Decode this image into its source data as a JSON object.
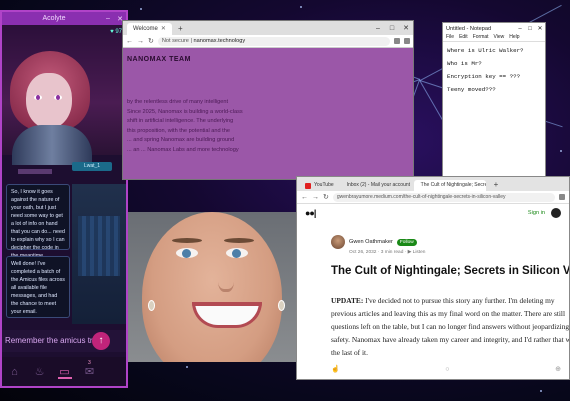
{
  "acolyte": {
    "title": "Acolyte",
    "indicator": "♥ 97",
    "name_tag": "Lwat_1",
    "chat_1": "So, I know it goes against the nature of your oath, but I just need some way to get a lot of info on hand that you can do... need to explain why so I can decipher the code in the meantime...",
    "chat_2": "Well done! I've completed a batch of the Amicus files across all available file messages, and had the chance to meet your email.",
    "prompt": "Remember the amicus trials",
    "nav_badge": "3"
  },
  "nanomax_browser": {
    "tab_label": "Welcome",
    "url_prefix": "Not secure",
    "url_domain": "nanomax.technology",
    "heading": "NANOMAX TEAM",
    "body_lines": [
      "by the relentless drive of many intelligent",
      "Since 2025, Nanomax is building a world-class",
      "shift in artificial intelligence. The underlying",
      "this proposition, with the potential and the",
      "... and spring Nanomax are building ground",
      "... an ... Nanomax Labs and more technology"
    ]
  },
  "notepad": {
    "title": "Untitled - Notepad",
    "menu": [
      "File",
      "Edit",
      "Format",
      "View",
      "Help"
    ],
    "lines": [
      "Where is Ulric Walker?",
      "Who is Mr?",
      "Encryption key == ???",
      "Teeny moved???"
    ]
  },
  "medium_browser": {
    "tabs": [
      "YouTube",
      "Inbox (2) - Mail your account",
      "The Cult of Nightingale; Secrets in"
    ],
    "url": "gwenbrayumore.medium.com/the-cult-of-nightingale-secrets-in-silicon-valley",
    "sign_in": "Sign in",
    "author_name": "Gwen Oathmaker",
    "follow_label": "Follow",
    "meta": "Oct 26, 2032 · 3 min read · ▶ Listen",
    "title": "The Cult of Nightingale; Secrets in Silicon Valley",
    "update_label": "UPDATE:",
    "body": "I've decided not to pursue this story any further. I'm deleting my previous articles and leaving this as my final word on the matter. There are still questions left on the table, but I can no longer find answers without jeopardizing my safety. Nanomax have already taken my career and integrity, and I'd rather that was the last of it."
  },
  "colors": {
    "acolyte_frame": "#b043c8",
    "nanomax_page": "#9b57a8",
    "medium_green": "#1a8917"
  }
}
